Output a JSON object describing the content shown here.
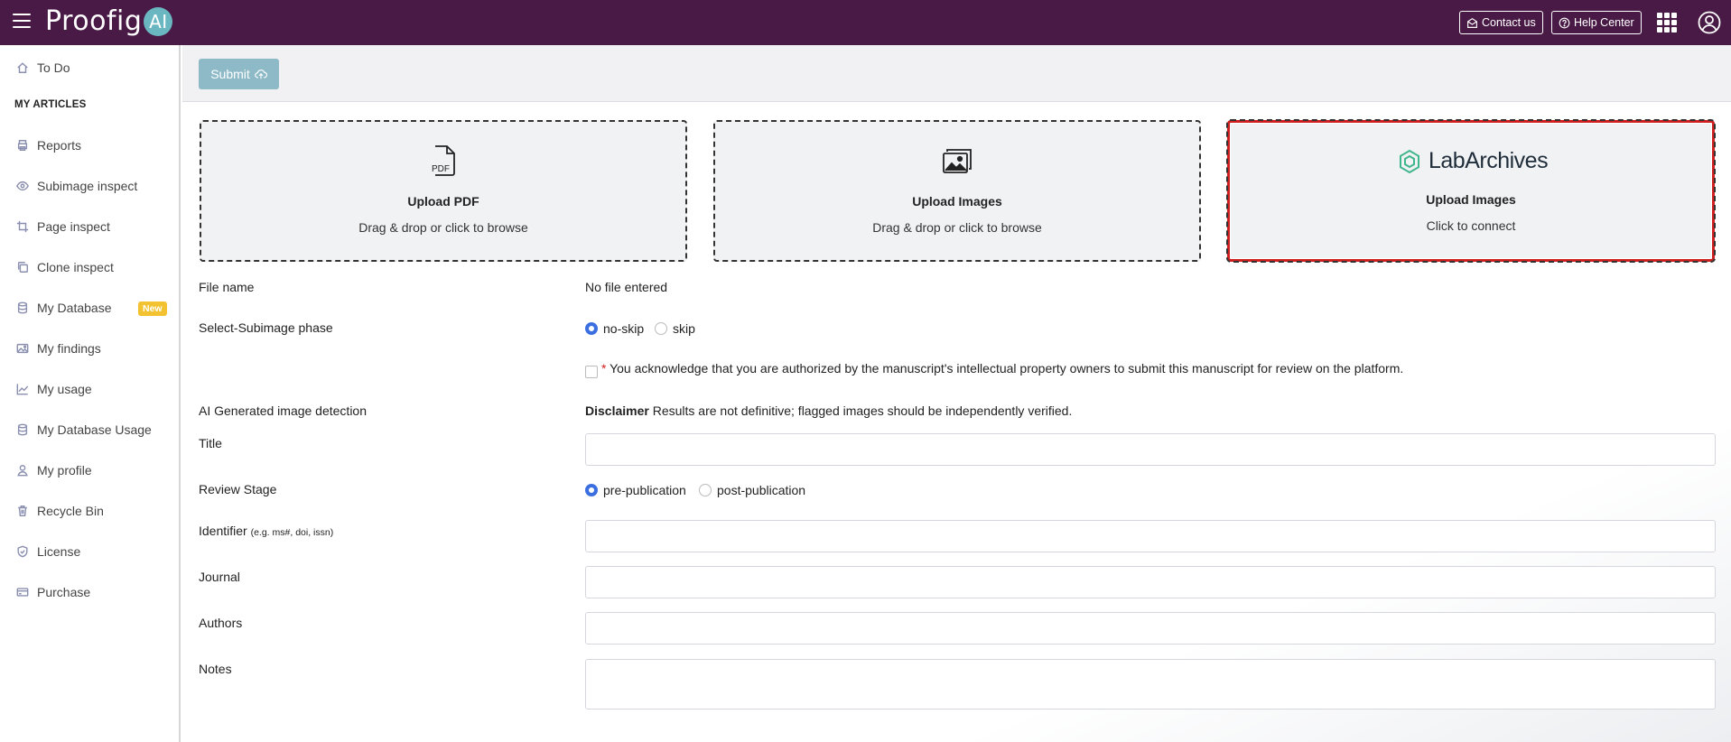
{
  "brand": {
    "logo_text": "Proofig",
    "logo_badge": "AI"
  },
  "topbar": {
    "contact_label": "Contact us",
    "help_label": "Help Center"
  },
  "sidebar": {
    "todo": "To Do",
    "heading": "MY ARTICLES",
    "items": [
      {
        "label": "Reports",
        "icon": "printer-icon"
      },
      {
        "label": "Subimage inspect",
        "icon": "eye-icon"
      },
      {
        "label": "Page inspect",
        "icon": "crop-icon"
      },
      {
        "label": "Clone inspect",
        "icon": "copy-icon"
      },
      {
        "label": "My Database",
        "icon": "database-icon",
        "badge": "New"
      },
      {
        "label": "My findings",
        "icon": "image-icon"
      },
      {
        "label": "My usage",
        "icon": "chart-line-icon"
      },
      {
        "label": "My Database Usage",
        "icon": "database-icon"
      },
      {
        "label": "My profile",
        "icon": "user-icon"
      },
      {
        "label": "Recycle Bin",
        "icon": "trash-icon"
      },
      {
        "label": "License",
        "icon": "shield-icon"
      },
      {
        "label": "Purchase",
        "icon": "credit-card-icon"
      }
    ]
  },
  "toolbar": {
    "submit_label": "Submit"
  },
  "uploads": {
    "pdf": {
      "icon_text": "PDF",
      "title": "Upload PDF",
      "sub": "Drag & drop or click to browse"
    },
    "images": {
      "title": "Upload Images",
      "sub": "Drag & drop or click to browse"
    },
    "labarchives": {
      "logo_text": "LabArchives",
      "title": "Upload Images",
      "sub": "Click to connect"
    }
  },
  "form": {
    "file_name_label": "File name",
    "file_name_value": "No file entered",
    "subimage_label": "Select-Subimage phase",
    "subimage_options": [
      "no-skip",
      "skip"
    ],
    "subimage_selected": "no-skip",
    "ack_star": "*",
    "ack_text": "You acknowledge that you are authorized by the manuscript's intellectual property owners to submit this manuscript for review on the platform.",
    "ai_label": "AI Generated image detection",
    "disclaimer_bold": "Disclaimer",
    "disclaimer_text": "Results are not definitive; flagged images should be independently verified.",
    "title_label": "Title",
    "review_label": "Review Stage",
    "review_options": [
      "pre-publication",
      "post-publication"
    ],
    "review_selected": "pre-publication",
    "identifier_label": "Identifier",
    "identifier_hint": "(e.g. ms#, doi, issn)",
    "journal_label": "Journal",
    "authors_label": "Authors",
    "notes_label": "Notes"
  },
  "colors": {
    "topbar": "#4a1a47",
    "accent": "#3b6fe0",
    "submit": "#8ebac8",
    "highlight": "#d01f1f"
  }
}
